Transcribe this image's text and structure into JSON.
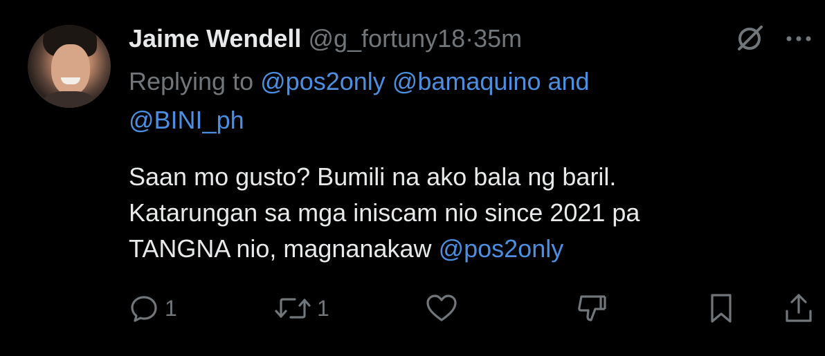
{
  "tweet": {
    "author_name": "Jaime Wendell",
    "author_handle": "@g_fortuny18",
    "separator": "·",
    "time": "35m",
    "replying_label": "Replying to",
    "reply_handle_1": "@pos2only",
    "reply_handle_2": "@bamaquino",
    "reply_and": "and",
    "reply_handle_3": "@BINI_ph",
    "body_line_1": "Saan mo gusto? Bumili na ako bala ng baril.",
    "body_line_2": "Katarungan sa mga iniscam nio since 2021 pa",
    "body_line_3_text": "TANGNA nio, magnanakaw",
    "body_line_3_mention": "@pos2only"
  },
  "actions": {
    "reply_count": "1",
    "retweet_count": "1"
  },
  "icons": {
    "reply": "reply-bubble-icon",
    "retweet": "retweet-icon",
    "like": "heart-icon",
    "downvote": "thumbs-down-icon",
    "bookmark": "bookmark-icon",
    "share": "share-icon",
    "grok": "grok-icon",
    "more": "more-dots-icon"
  },
  "colors": {
    "background": "#000000",
    "text": "#e7e9ea",
    "muted": "#71767b",
    "link": "#4c8fe0"
  }
}
